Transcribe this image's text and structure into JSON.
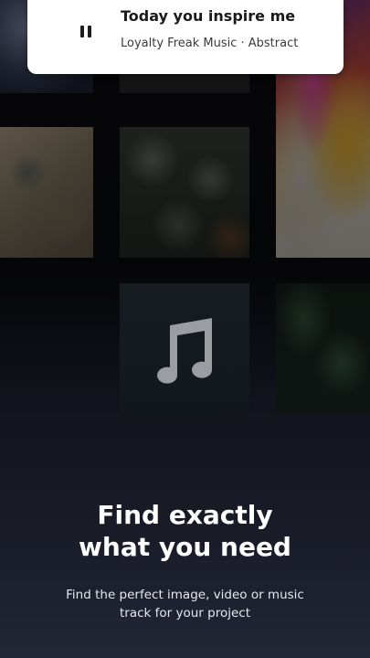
{
  "now_playing": {
    "title": "Today you inspire me",
    "subtitle": "Loyalty Freak Music · Abstract",
    "control_icon": "pause-icon"
  },
  "onboarding": {
    "headline_line1": "Find exactly",
    "headline_line2": "what you need",
    "description_line1": "Find the perfect image, video or music",
    "description_line2": "track for your project"
  },
  "icons": {
    "center_icon": "music-note-icon"
  },
  "colors": {
    "background_top": "#0b0c10",
    "background_bottom": "#232636",
    "card": "#ffffff",
    "text_light": "#ffffff"
  }
}
